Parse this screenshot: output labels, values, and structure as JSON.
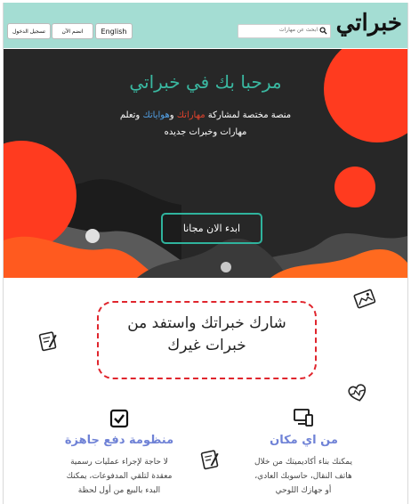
{
  "header": {
    "brand": "خبراتي",
    "search_placeholder": "ابحث عن مهارات",
    "lang_button": "English",
    "join_button": "انضم الآن",
    "login_button": "تسجيل الدخول"
  },
  "hero": {
    "title": "مرحبا بك في خبراتي",
    "desc_part1": "منصة مختصة لمشاركة ",
    "desc_highlight1": "مهاراتك",
    "desc_part2": " و",
    "desc_highlight2": "هواياتك",
    "desc_part3": " وتعلم",
    "desc_line2": "مهارات وخبرات جديده",
    "cta_label": "ابدء الان مجانا"
  },
  "share": {
    "line1": "شارك خبراتك واستفد من",
    "line2": "خبرات غيرك"
  },
  "features": [
    {
      "title": "من اي مكان",
      "desc_line1": "يمكنك بناء أكاديميتك من خلال",
      "desc_line2": "هاتف النقال، حاسوبك العادي،",
      "desc_line3": "أو جهازك اللوحي",
      "icon": "devices-icon"
    },
    {
      "title": "منظومة دفع جاهزة",
      "desc_line1": "لا حاجة لإجراء عمليات رسمية",
      "desc_line2": "معقدة لتلقي المدفوعات، يمكنك",
      "desc_line3": "البدء بالبيع من أول لحظة",
      "icon": "checkbox-icon"
    }
  ],
  "colors": {
    "header_bg": "#a4ddd3",
    "accent_teal": "#3ab8a1",
    "accent_red": "#e2432c",
    "feature_title": "#6f82d6",
    "hero_bg": "#272727"
  }
}
